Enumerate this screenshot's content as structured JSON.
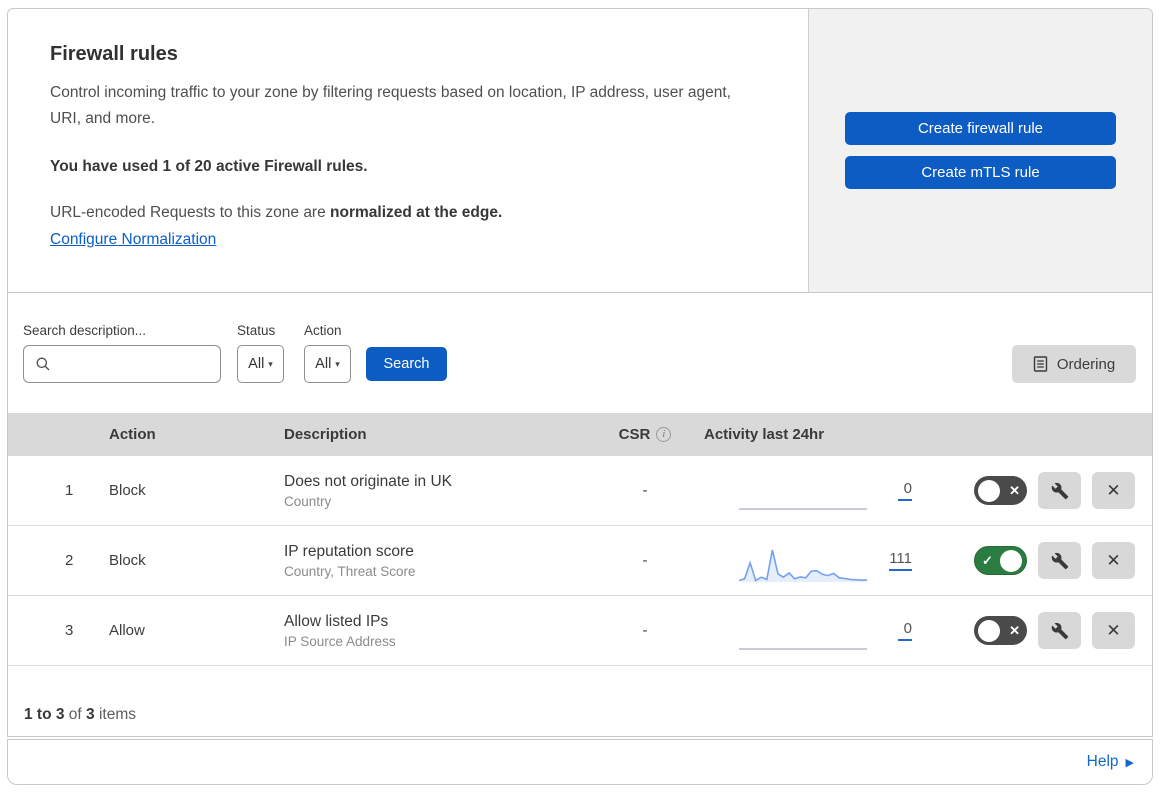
{
  "colors": {
    "accent_blue": "#0d5cc4",
    "link_blue": "#0b5fc7",
    "help_blue": "#1368cc",
    "toggle_on_green": "#2b7c41",
    "toggle_off_gray": "#4a4a4a",
    "sparkline_blue": "#74a0ee",
    "table_header_gray": "#d9d9d9",
    "side_panel_gray": "#f1f1f1"
  },
  "icons": {
    "caret": "▾",
    "info": "i",
    "close": "✕",
    "check": "✓",
    "help_arrow": "▶"
  },
  "header": {
    "title": "Firewall rules",
    "description": "Control incoming traffic to your zone by filtering requests based on location, IP address, user agent, URI, and more.",
    "usage": "You have used 1 of 20 active Firewall rules.",
    "normalization_text": "URL-encoded Requests to this zone are ",
    "normalization_bold": "normalized at the edge.",
    "normalization_link": "Configure Normalization",
    "buttons": {
      "create_firewall": "Create firewall rule",
      "create_mtls": "Create mTLS rule"
    }
  },
  "filters": {
    "search_label": "Search description...",
    "status_label": "Status",
    "status_value": "All",
    "action_label": "Action",
    "action_value": "All",
    "search_button": "Search",
    "ordering_button": "Ordering"
  },
  "table": {
    "columns": {
      "action": "Action",
      "description": "Description",
      "csr": "CSR",
      "activity": "Activity last 24hr"
    },
    "rows": [
      {
        "priority": "1",
        "action": "Block",
        "description": "Does not originate in UK",
        "fields": "Country",
        "csr": "-",
        "activity_count": "0",
        "enabled": false
      },
      {
        "priority": "2",
        "action": "Block",
        "description": "IP reputation score",
        "fields": "Country, Threat Score",
        "csr": "-",
        "activity_count": "111",
        "enabled": true
      },
      {
        "priority": "3",
        "action": "Allow",
        "description": "Allow listed IPs",
        "fields": "IP Source Address",
        "csr": "-",
        "activity_count": "0",
        "enabled": false
      }
    ]
  },
  "footer": {
    "range": "1 to 3",
    "of_word": " of ",
    "total": "3",
    "items_word": " items",
    "help": "Help"
  },
  "chart_data": {
    "type": "area",
    "context": "Activity last 24hr sparkline for rule 2 (IP reputation score)",
    "values": [
      5,
      10,
      60,
      5,
      15,
      8,
      100,
      25,
      15,
      28,
      10,
      16,
      13,
      34,
      35,
      24,
      20,
      27,
      13,
      11,
      8,
      7,
      6,
      6
    ],
    "ylim": [
      0,
      100
    ],
    "total_requests": 111
  }
}
